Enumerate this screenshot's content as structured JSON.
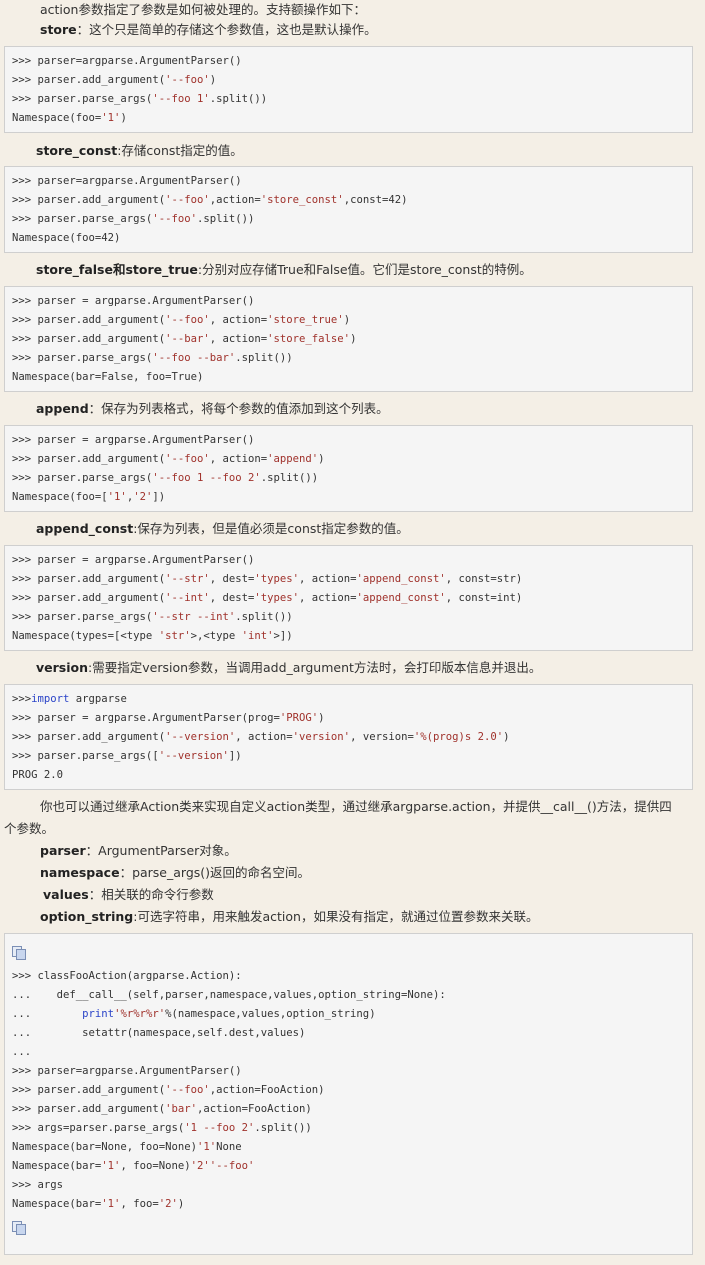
{
  "intro": {
    "line1": "action参数指定了参数是如何被处理的。支持额操作如下：",
    "store_term": "store",
    "store_desc": "：这个只是简单的存储这个参数值，这也是默认操作。"
  },
  "code_store": [
    ">>> parser=argparse.ArgumentParser()",
    ">>> parser.add_argument('--foo')",
    ">>> parser.parse_args('--foo 1'.split())",
    "Namespace(foo='1')"
  ],
  "store_const": {
    "term": "store_const",
    "desc": ":存储const指定的值。"
  },
  "code_store_const": [
    ">>> parser=argparse.ArgumentParser()",
    ">>> parser.add_argument('--foo',action='store_const',const=42)",
    ">>> parser.parse_args('--foo'.split())",
    "Namespace(foo=42)"
  ],
  "store_bool": {
    "term": "store_false和store_true",
    "desc": ":分别对应存储True和False值。它们是store_const的特例。"
  },
  "code_store_bool": [
    ">>> parser = argparse.ArgumentParser()",
    ">>> parser.add_argument('--foo', action='store_true')",
    ">>> parser.add_argument('--bar', action='store_false')",
    ">>> parser.parse_args('--foo --bar'.split())",
    "Namespace(bar=False, foo=True)"
  ],
  "append": {
    "term": "append",
    "desc": "：保存为列表格式，将每个参数的值添加到这个列表。"
  },
  "code_append": [
    ">>> parser = argparse.ArgumentParser()",
    ">>> parser.add_argument('--foo', action='append')",
    ">>> parser.parse_args('--foo 1 --foo 2'.split())",
    "Namespace(foo=['1','2'])"
  ],
  "append_const": {
    "term": "append_const",
    "desc": ":保存为列表，但是值必须是const指定参数的值。"
  },
  "code_append_const": [
    ">>> parser = argparse.ArgumentParser()",
    ">>> parser.add_argument('--str', dest='types', action='append_const', const=str)",
    ">>> parser.add_argument('--int', dest='types', action='append_const', const=int)",
    ">>> parser.parse_args('--str --int'.split())",
    "Namespace(types=[<type 'str'>,<type 'int'>])"
  ],
  "version": {
    "term": "version",
    "desc": ":需要指定version参数，当调用add_argument方法时，会打印版本信息并退出。"
  },
  "code_version": [
    ">>>import argparse",
    ">>> parser = argparse.ArgumentParser(prog='PROG')",
    ">>> parser.add_argument('--version', action='version', version='%(prog)s 2.0')",
    ">>> parser.parse_args(['--version'])",
    "PROG 2.0"
  ],
  "custom": {
    "line1": "你也可以通过继承Action类来实现自定义action类型，通过继承argparse.action，并提供__call__()方法，提供四",
    "line2": "个参数。",
    "parser_term": "parser",
    "parser_desc": "：ArgumentParser对象。",
    "namespace_term": "namespace",
    "namespace_desc": "：parse_args()返回的命名空间。",
    "values_term": "values",
    "values_desc": "：相关联的命令行参数",
    "option_term": "option_string",
    "option_desc": ":可选字符串，用来触发action，如果没有指定，就通过位置参数来关联。"
  },
  "code_custom": [
    ">>> classFooAction(argparse.Action):",
    "...    def__call__(self,parser,namespace,values,option_string=None):",
    "...        print'%r%r%r'%(namespace,values,option_string)",
    "...        setattr(namespace,self.dest,values)",
    "...",
    ">>> parser=argparse.ArgumentParser()",
    ">>> parser.add_argument('--foo',action=FooAction)",
    ">>> parser.add_argument('bar',action=FooAction)",
    ">>> args=parser.parse_args('1 --foo 2'.split())",
    "Namespace(bar=None, foo=None)'1'None",
    "Namespace(bar='1', foo=None)'2''--foo'",
    ">>> args",
    "Namespace(bar='1', foo='2')"
  ],
  "icons": {
    "copy": "copy-code-icon"
  },
  "colors": {
    "background": "#f4efe6",
    "code_bg": "#f5f5f5",
    "string": "#a0322c",
    "keyword": "#2b44c8"
  }
}
